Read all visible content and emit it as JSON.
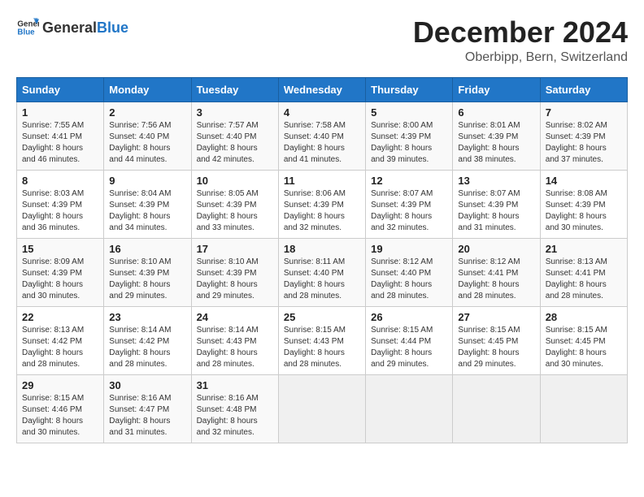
{
  "header": {
    "logo_general": "General",
    "logo_blue": "Blue",
    "title": "December 2024",
    "subtitle": "Oberbipp, Bern, Switzerland"
  },
  "calendar": {
    "days_of_week": [
      "Sunday",
      "Monday",
      "Tuesday",
      "Wednesday",
      "Thursday",
      "Friday",
      "Saturday"
    ],
    "weeks": [
      [
        {
          "day": "1",
          "sunrise": "7:55 AM",
          "sunset": "4:41 PM",
          "daylight": "8 hours and 46 minutes."
        },
        {
          "day": "2",
          "sunrise": "7:56 AM",
          "sunset": "4:40 PM",
          "daylight": "8 hours and 44 minutes."
        },
        {
          "day": "3",
          "sunrise": "7:57 AM",
          "sunset": "4:40 PM",
          "daylight": "8 hours and 42 minutes."
        },
        {
          "day": "4",
          "sunrise": "7:58 AM",
          "sunset": "4:40 PM",
          "daylight": "8 hours and 41 minutes."
        },
        {
          "day": "5",
          "sunrise": "8:00 AM",
          "sunset": "4:39 PM",
          "daylight": "8 hours and 39 minutes."
        },
        {
          "day": "6",
          "sunrise": "8:01 AM",
          "sunset": "4:39 PM",
          "daylight": "8 hours and 38 minutes."
        },
        {
          "day": "7",
          "sunrise": "8:02 AM",
          "sunset": "4:39 PM",
          "daylight": "8 hours and 37 minutes."
        }
      ],
      [
        {
          "day": "8",
          "sunrise": "8:03 AM",
          "sunset": "4:39 PM",
          "daylight": "8 hours and 36 minutes."
        },
        {
          "day": "9",
          "sunrise": "8:04 AM",
          "sunset": "4:39 PM",
          "daylight": "8 hours and 34 minutes."
        },
        {
          "day": "10",
          "sunrise": "8:05 AM",
          "sunset": "4:39 PM",
          "daylight": "8 hours and 33 minutes."
        },
        {
          "day": "11",
          "sunrise": "8:06 AM",
          "sunset": "4:39 PM",
          "daylight": "8 hours and 32 minutes."
        },
        {
          "day": "12",
          "sunrise": "8:07 AM",
          "sunset": "4:39 PM",
          "daylight": "8 hours and 32 minutes."
        },
        {
          "day": "13",
          "sunrise": "8:07 AM",
          "sunset": "4:39 PM",
          "daylight": "8 hours and 31 minutes."
        },
        {
          "day": "14",
          "sunrise": "8:08 AM",
          "sunset": "4:39 PM",
          "daylight": "8 hours and 30 minutes."
        }
      ],
      [
        {
          "day": "15",
          "sunrise": "8:09 AM",
          "sunset": "4:39 PM",
          "daylight": "8 hours and 30 minutes."
        },
        {
          "day": "16",
          "sunrise": "8:10 AM",
          "sunset": "4:39 PM",
          "daylight": "8 hours and 29 minutes."
        },
        {
          "day": "17",
          "sunrise": "8:10 AM",
          "sunset": "4:39 PM",
          "daylight": "8 hours and 29 minutes."
        },
        {
          "day": "18",
          "sunrise": "8:11 AM",
          "sunset": "4:40 PM",
          "daylight": "8 hours and 28 minutes."
        },
        {
          "day": "19",
          "sunrise": "8:12 AM",
          "sunset": "4:40 PM",
          "daylight": "8 hours and 28 minutes."
        },
        {
          "day": "20",
          "sunrise": "8:12 AM",
          "sunset": "4:41 PM",
          "daylight": "8 hours and 28 minutes."
        },
        {
          "day": "21",
          "sunrise": "8:13 AM",
          "sunset": "4:41 PM",
          "daylight": "8 hours and 28 minutes."
        }
      ],
      [
        {
          "day": "22",
          "sunrise": "8:13 AM",
          "sunset": "4:42 PM",
          "daylight": "8 hours and 28 minutes."
        },
        {
          "day": "23",
          "sunrise": "8:14 AM",
          "sunset": "4:42 PM",
          "daylight": "8 hours and 28 minutes."
        },
        {
          "day": "24",
          "sunrise": "8:14 AM",
          "sunset": "4:43 PM",
          "daylight": "8 hours and 28 minutes."
        },
        {
          "day": "25",
          "sunrise": "8:15 AM",
          "sunset": "4:43 PM",
          "daylight": "8 hours and 28 minutes."
        },
        {
          "day": "26",
          "sunrise": "8:15 AM",
          "sunset": "4:44 PM",
          "daylight": "8 hours and 29 minutes."
        },
        {
          "day": "27",
          "sunrise": "8:15 AM",
          "sunset": "4:45 PM",
          "daylight": "8 hours and 29 minutes."
        },
        {
          "day": "28",
          "sunrise": "8:15 AM",
          "sunset": "4:45 PM",
          "daylight": "8 hours and 30 minutes."
        }
      ],
      [
        {
          "day": "29",
          "sunrise": "8:15 AM",
          "sunset": "4:46 PM",
          "daylight": "8 hours and 30 minutes."
        },
        {
          "day": "30",
          "sunrise": "8:16 AM",
          "sunset": "4:47 PM",
          "daylight": "8 hours and 31 minutes."
        },
        {
          "day": "31",
          "sunrise": "8:16 AM",
          "sunset": "4:48 PM",
          "daylight": "8 hours and 32 minutes."
        },
        null,
        null,
        null,
        null
      ]
    ]
  }
}
